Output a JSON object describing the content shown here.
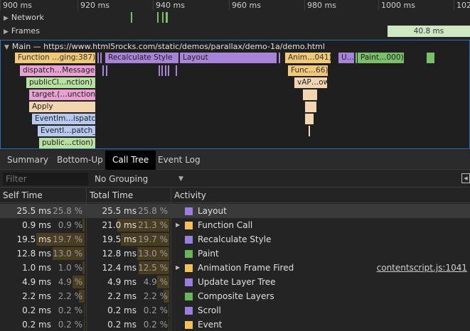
{
  "ruler": {
    "ticks": [
      "900 ms",
      "920 ms",
      "940 ms",
      "960 ms",
      "980 ms",
      "1000 ms",
      "1020"
    ]
  },
  "tracks": {
    "network": "Network",
    "frames": "Frames",
    "frame_duration": "40.8 ms",
    "main": "Main — https://www.html5rocks.com/static/demos/parallax/demo-1a/demo.html"
  },
  "flame": {
    "function_call": "Function …ging:387)",
    "recalc": "Recalculate Style",
    "layout": "Layout",
    "anim": "Anim…041)",
    "u": "U…",
    "paint": "Paint…000)",
    "dispatch": "dispatch…Message",
    "public_cl": "publicCl…nction)",
    "target": "target.(…unction)",
    "apply": "Apply",
    "event_im": "EventIm…ispatch",
    "eventi": "EventI…patch_",
    "public": "public…ction)",
    "func66": "Func…66)",
    "vap": "vAP…ow"
  },
  "tabs": [
    "Summary",
    "Bottom-Up",
    "Call Tree",
    "Event Log"
  ],
  "filter": {
    "placeholder": "Filter",
    "grouping": "No Grouping"
  },
  "columns": {
    "self": "Self Time",
    "total": "Total Time",
    "activity": "Activity"
  },
  "colors": {
    "rendering": "#9b7fe0",
    "scripting": "#f2c15e",
    "painting": "#6ab45b"
  },
  "rows": [
    {
      "self_ms": "25.5 ms",
      "self_pct": "25.8 %",
      "self_frac": 0.258,
      "total_ms": "25.5 ms",
      "total_pct": "25.8 %",
      "total_frac": 0.258,
      "expand": "",
      "activity": "Layout",
      "color": "#9b7fe0",
      "link": ""
    },
    {
      "self_ms": "0.9 ms",
      "self_pct": "0.9 %",
      "self_frac": 0.009,
      "total_ms": "21.0 ms",
      "total_pct": "21.3 %",
      "total_frac": 0.213,
      "expand": "▶",
      "activity": "Function Call",
      "color": "#f2c15e",
      "link": ""
    },
    {
      "self_ms": "19.5 ms",
      "self_pct": "19.7 %",
      "self_frac": 0.197,
      "total_ms": "19.5 ms",
      "total_pct": "19.7 %",
      "total_frac": 0.197,
      "expand": "",
      "activity": "Recalculate Style",
      "color": "#9b7fe0",
      "link": ""
    },
    {
      "self_ms": "12.8 ms",
      "self_pct": "13.0 %",
      "self_frac": 0.13,
      "total_ms": "12.8 ms",
      "total_pct": "13.0 %",
      "total_frac": 0.13,
      "expand": "",
      "activity": "Paint",
      "color": "#6ab45b",
      "link": ""
    },
    {
      "self_ms": "1.0 ms",
      "self_pct": "1.0 %",
      "self_frac": 0.01,
      "total_ms": "12.4 ms",
      "total_pct": "12.5 %",
      "total_frac": 0.125,
      "expand": "▶",
      "activity": "Animation Frame Fired",
      "color": "#f2c15e",
      "link": "contentscript.js:1041"
    },
    {
      "self_ms": "4.9 ms",
      "self_pct": "4.9 %",
      "self_frac": 0.049,
      "total_ms": "4.9 ms",
      "total_pct": "4.9 %",
      "total_frac": 0.049,
      "expand": "",
      "activity": "Update Layer Tree",
      "color": "#9b7fe0",
      "link": ""
    },
    {
      "self_ms": "2.2 ms",
      "self_pct": "2.2 %",
      "self_frac": 0.022,
      "total_ms": "2.2 ms",
      "total_pct": "2.2 %",
      "total_frac": 0.022,
      "expand": "",
      "activity": "Composite Layers",
      "color": "#6ab45b",
      "link": ""
    },
    {
      "self_ms": "0.2 ms",
      "self_pct": "0.2 %",
      "self_frac": 0.002,
      "total_ms": "0.2 ms",
      "total_pct": "0.2 %",
      "total_frac": 0.002,
      "expand": "",
      "activity": "Scroll",
      "color": "#9b7fe0",
      "link": ""
    },
    {
      "self_ms": "0.2 ms",
      "self_pct": "0.2 %",
      "self_frac": 0.002,
      "total_ms": "0.2 ms",
      "total_pct": "0.2 %",
      "total_frac": 0.002,
      "expand": "",
      "activity": "Event",
      "color": "#f2c15e",
      "link": ""
    }
  ]
}
